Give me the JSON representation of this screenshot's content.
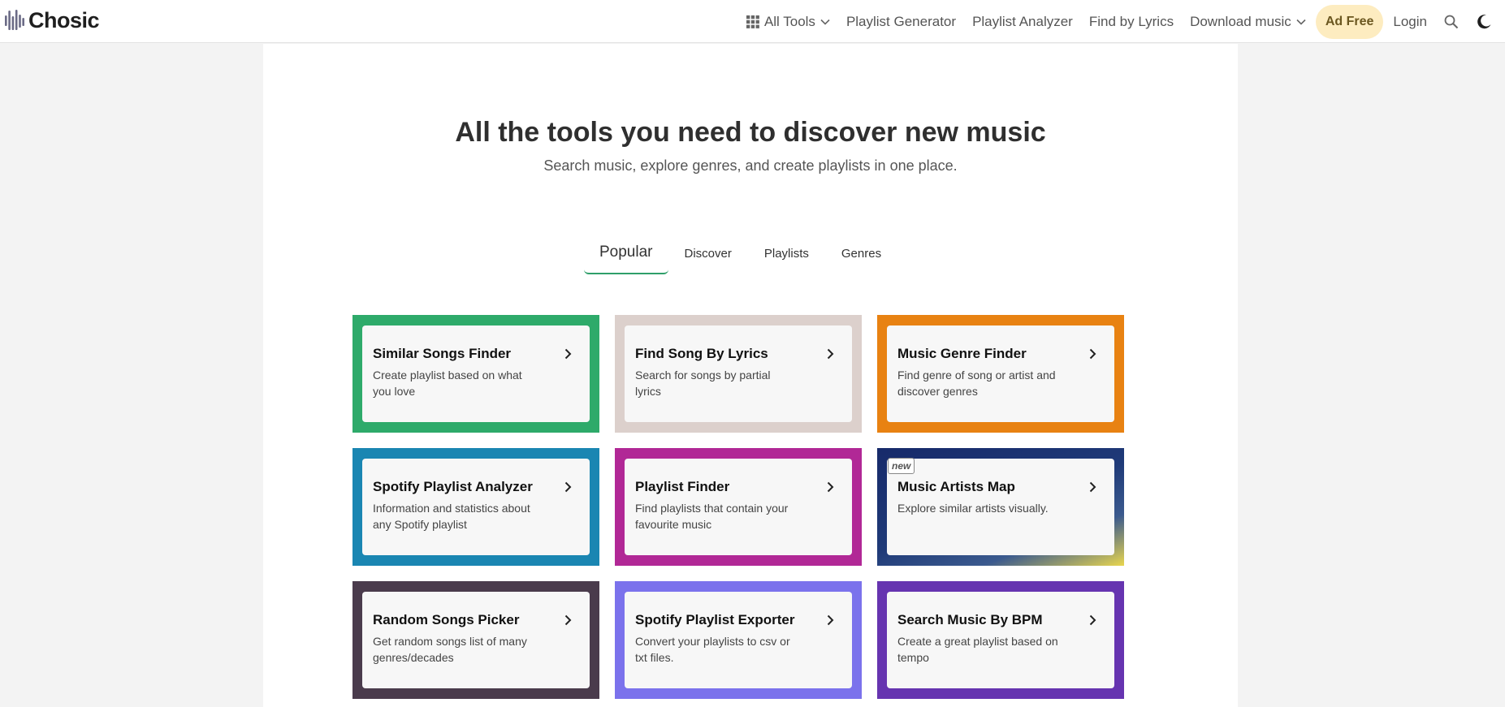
{
  "header": {
    "logo_text": "Chosic",
    "nav": {
      "all_tools": "All Tools",
      "playlist_generator": "Playlist Generator",
      "playlist_analyzer": "Playlist Analyzer",
      "find_by_lyrics": "Find by Lyrics",
      "download_music": "Download music",
      "ad_free": "Ad Free",
      "login": "Login"
    }
  },
  "hero": {
    "title": "All the tools you need to discover new music",
    "subtitle": "Search music, explore genres, and create playlists in one place."
  },
  "tabs": [
    {
      "label": "Popular",
      "active": true
    },
    {
      "label": "Discover",
      "active": false
    },
    {
      "label": "Playlists",
      "active": false
    },
    {
      "label": "Genres",
      "active": false
    }
  ],
  "cards": [
    {
      "title": "Similar Songs Finder",
      "desc": "Create playlist based on what you love",
      "border": "#2eaa6a"
    },
    {
      "title": "Find Song By Lyrics",
      "desc": "Search for songs by partial lyrics",
      "border": "#dcd0cc"
    },
    {
      "title": "Music Genre Finder",
      "desc": "Find genre of song or artist and discover genres",
      "border": "#e88212"
    },
    {
      "title": "Spotify Playlist Analyzer",
      "desc": "Information and statistics about any Spotify playlist",
      "border": "#1a86b2"
    },
    {
      "title": "Playlist Finder",
      "desc": "Find playlists that contain your favourite music",
      "border": "#b12896"
    },
    {
      "title": "Music Artists Map",
      "desc": "Explore similar artists visually.",
      "border": "gradient #172a6a → #e9d64e",
      "badge": "new"
    },
    {
      "title": "Random Songs Picker",
      "desc": "Get random songs list of many genres/decades",
      "border": "#4a3b4c"
    },
    {
      "title": "Spotify Playlist Exporter",
      "desc": "Convert your playlists to csv or txt files.",
      "border": "#7b72ec"
    },
    {
      "title": "Search Music By BPM",
      "desc": "Create a great playlist based on tempo",
      "border": "#6634b0"
    }
  ]
}
